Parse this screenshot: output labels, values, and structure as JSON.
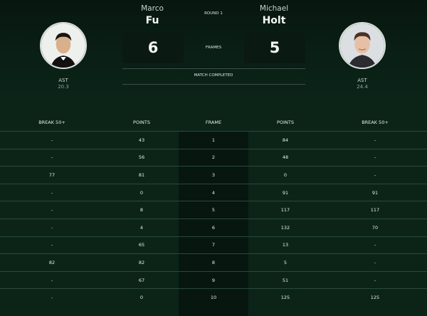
{
  "match": {
    "round": "ROUND 1",
    "frames_label": "FRAMES",
    "status": "MATCH COMPLETED",
    "player1": {
      "first_name": "Marco",
      "last_name": "Fu",
      "score": "6",
      "nationality": "AST",
      "average": "20.3"
    },
    "player2": {
      "first_name": "Michael",
      "last_name": "Holt",
      "score": "5",
      "nationality": "AST",
      "average": "24.4"
    }
  },
  "table": {
    "headers": [
      "BREAK 50+",
      "POINTS",
      "FRAME",
      "POINTS",
      "BREAK 50+"
    ],
    "rows": [
      [
        "-",
        "43",
        "1",
        "84",
        "-"
      ],
      [
        "-",
        "56",
        "2",
        "48",
        "-"
      ],
      [
        "77",
        "81",
        "3",
        "0",
        "-"
      ],
      [
        "-",
        "0",
        "4",
        "91",
        "91"
      ],
      [
        "-",
        "8",
        "5",
        "117",
        "117"
      ],
      [
        "-",
        "4",
        "6",
        "132",
        "70"
      ],
      [
        "-",
        "65",
        "7",
        "13",
        "-"
      ],
      [
        "82",
        "82",
        "8",
        "5",
        "-"
      ],
      [
        "-",
        "67",
        "9",
        "51",
        "-"
      ],
      [
        "-",
        "0",
        "10",
        "125",
        "125"
      ]
    ]
  },
  "colors": {
    "background": "#0c2418",
    "header": "#07170f",
    "score_box": "#0a1912",
    "row_border": "#2a4a3a"
  }
}
